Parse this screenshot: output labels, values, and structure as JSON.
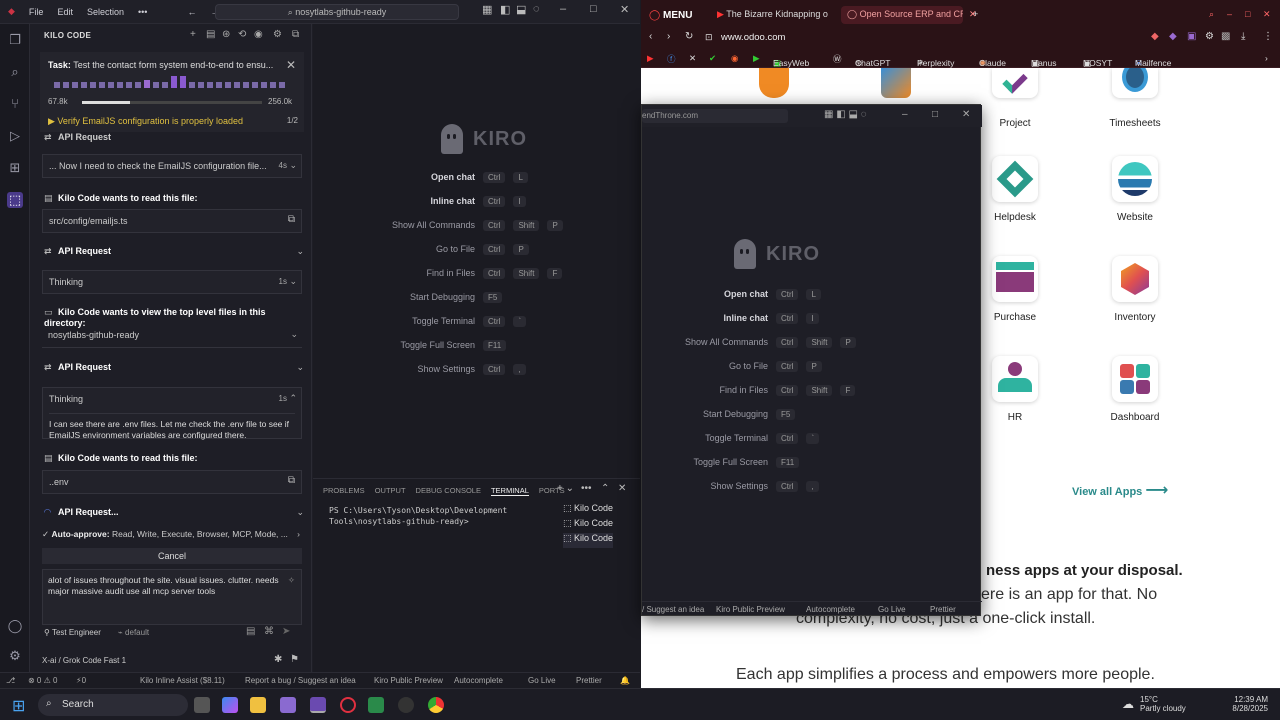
{
  "ide": {
    "menu": [
      "File",
      "Edit",
      "Selection"
    ],
    "more": "•••",
    "search": "nosytlabs-github-ready",
    "panel_title": "KILO CODE",
    "task": {
      "label": "Task:",
      "text": "Test the contact form system end-to-end to ensu...",
      "tokens_in": "67.8k",
      "tokens_max": "256.0k",
      "token_fill_fraction": 0.265,
      "todo": "Verify EmailJS configuration is properly loaded",
      "todo_count": "1/2"
    },
    "messages": {
      "m1_header": "API Request",
      "m2_text": "... Now I need to check the EmailJS configuration file...",
      "m2_time": "4s",
      "m3_header": "Kilo Code wants to read this file:",
      "m3_file": "src/config/emailjs.ts",
      "m4_header": "API Request",
      "m5_text": "Thinking",
      "m5_time": "1s",
      "m6_header": "Kilo Code wants to view the top level files in this directory:",
      "m6_dir": "nosytlabs-github-ready",
      "m7_header": "API Request",
      "m8_text": "Thinking",
      "m8_time": "1s",
      "m8_body": "I can see there are .env files. Let me check the .env file to see if EmailJS environment variables are configured there.",
      "m9_header": "Kilo Code wants to read this file:",
      "m9_file": "..env",
      "m10_header": "API Request..."
    },
    "auto_approve_label": "Auto-approve:",
    "auto_approve_text": "Read, Write, Execute, Browser, MCP, Mode, ...",
    "cancel": "Cancel",
    "input_text": "alot of issues throughout the site. visual issues. clutter. needs major massive audit use all mcp server tools",
    "mode": "Test Engineer",
    "profile": "default",
    "model": "X-ai / Grok Code Fast 1",
    "kiro": {
      "word": "KIRO",
      "shortcuts": [
        {
          "label": "Open chat",
          "keys": [
            "Ctrl",
            "L"
          ]
        },
        {
          "label": "Inline chat",
          "keys": [
            "Ctrl",
            "I"
          ]
        },
        {
          "label": "Show All Commands",
          "keys": [
            "Ctrl",
            "Shift",
            "P"
          ]
        },
        {
          "label": "Go to File",
          "keys": [
            "Ctrl",
            "P"
          ]
        },
        {
          "label": "Find in Files",
          "keys": [
            "Ctrl",
            "Shift",
            "F"
          ]
        },
        {
          "label": "Start Debugging",
          "keys": [
            "F5"
          ]
        },
        {
          "label": "Toggle Terminal",
          "keys": [
            "Ctrl",
            "`"
          ]
        },
        {
          "label": "Toggle Full Screen",
          "keys": [
            "F11"
          ]
        },
        {
          "label": "Show Settings",
          "keys": [
            "Ctrl",
            ","
          ]
        }
      ]
    },
    "terminal": {
      "tabs": [
        "PROBLEMS",
        "OUTPUT",
        "DEBUG CONSOLE",
        "TERMINAL",
        "PORTS"
      ],
      "text": "PS C:\\Users\\Tyson\\Desktop\\Development Tools\\nosytlabs-github-ready>",
      "sessions": [
        "Kilo Code",
        "Kilo Code",
        "Kilo Code"
      ]
    },
    "status": {
      "problems": "⊗ 0 ⚠ 0",
      "ports": "⚡0",
      "kilo": "Kilo Inline Assist ($8.11)",
      "report": "Report a bug / Suggest an idea",
      "preview": "Kiro Public Preview",
      "autocomplete": "Autocomplete",
      "golive": "Go Live",
      "prettier": "Prettier"
    }
  },
  "float_window": {
    "title": "endThrone.com",
    "status": {
      "report": "/ Suggest an idea",
      "preview": "Kiro Public Preview",
      "autocomplete": "Autocomplete",
      "golive": "Go Live",
      "prettier": "Prettier"
    }
  },
  "browser": {
    "menu": "MENU",
    "tabs": [
      "The Bizarre Kidnapping o",
      "Open Source ERP and CR"
    ],
    "url": "www.odoo.com",
    "bookmarks": [
      "EasyWeb",
      "ChatGPT",
      "Perplexity",
      "Claude",
      "Manus",
      "NOSYT",
      "Mailfence"
    ],
    "apps": [
      "Project",
      "Timesheets",
      "Helpdesk",
      "Website",
      "Purchase",
      "Inventory",
      "HR",
      "Dashboard"
    ],
    "view_all": "View all Apps",
    "headline": "ness apps at your disposal.",
    "line2": "ere is an app for that. No",
    "line3": "complexity, no cost, just a one-click install.",
    "line4": "Each app simplifies a process and empowers more people."
  },
  "taskbar": {
    "search": "Search",
    "weather_temp": "15°C",
    "weather_text": "Partly cloudy",
    "time": "12:39 AM",
    "date": "8/28/2025"
  }
}
